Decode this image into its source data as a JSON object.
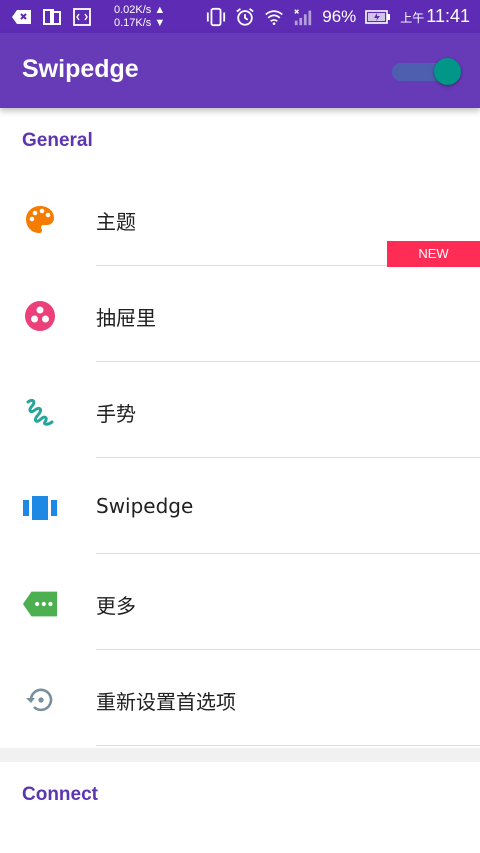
{
  "status_bar": {
    "speed_up": "0.02K/s ▲",
    "speed_down": "0.17K/s ▼",
    "battery": "96%",
    "time_prefix": "上午",
    "time": "11:41"
  },
  "app_bar": {
    "title": "Swipedge",
    "toggle_on": true
  },
  "general": {
    "header": "General",
    "items": [
      {
        "label": "主题",
        "icon": "palette-icon",
        "badge": "NEW"
      },
      {
        "label": "抽屉里",
        "icon": "drawer-icon"
      },
      {
        "label": "手势",
        "icon": "gesture-icon"
      },
      {
        "label": "Swipedge",
        "icon": "carousel-icon"
      },
      {
        "label": "更多",
        "icon": "more-tag-icon"
      },
      {
        "label": "重新设置首选项",
        "icon": "restore-icon"
      }
    ]
  },
  "connect": {
    "header": "Connect"
  },
  "colors": {
    "status_bar": "#5e2cb4",
    "app_bar": "#673ab7",
    "accent": "#009688",
    "section_header": "#5e35b1",
    "badge": "#ff2d55"
  }
}
